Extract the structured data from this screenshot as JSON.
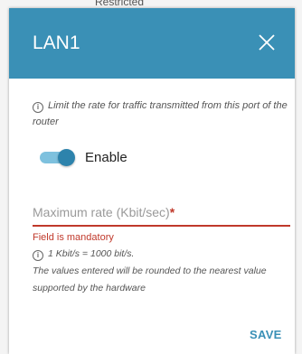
{
  "background": {
    "fragment_text": "Restricted"
  },
  "dialog": {
    "title": "LAN1",
    "close_icon": "close-icon",
    "info_text": "Limit the rate for traffic transmitted from this port of the router",
    "toggle": {
      "label": "Enable",
      "checked": true
    },
    "max_rate": {
      "placeholder": "Maximum rate (Kbit/sec)",
      "required_mark": "*",
      "value": ""
    },
    "error_text": "Field is mandatory",
    "note_line1": "1 Kbit/s = 1000 bit/s.",
    "note_line2": "The values entered will be rounded to the nearest value supported by the hardware",
    "save_label": "SAVE"
  },
  "colors": {
    "header": "#3a90b6",
    "error": "#c0392b",
    "toggle_track": "#7ec1de",
    "toggle_knob": "#2d83ac",
    "save": "#3a90b6"
  }
}
